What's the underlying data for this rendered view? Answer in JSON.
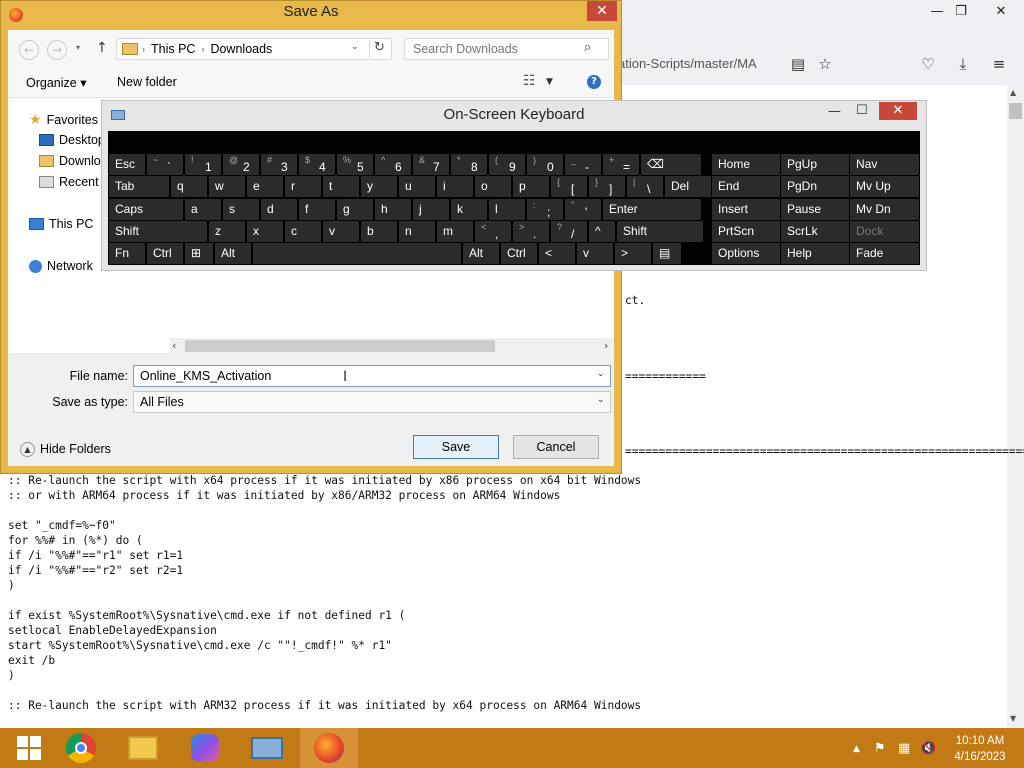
{
  "browser": {
    "url_fragment": "ation-Scripts/master/MA",
    "icons": [
      "reader-icon",
      "star-icon",
      "pocket-icon",
      "download-icon",
      "menu-icon"
    ],
    "partial_text_1": "ct.",
    "partial_text_2": "============",
    "partial_text_3": "==================================================================",
    "code_lines": [
      ":: Re-launch the script with x64 process if it was initiated by x86 process on x64 bit Windows",
      ":: or with ARM64 process if it was initiated by x86/ARM32 process on ARM64 Windows",
      "",
      "set \"_cmdf=%~f0\"",
      "for %%# in (%*) do (",
      "if /i \"%%#\"==\"r1\" set r1=1",
      "if /i \"%%#\"==\"r2\" set r2=1",
      ")",
      "",
      "if exist %SystemRoot%\\Sysnative\\cmd.exe if not defined r1 (",
      "setlocal EnableDelayedExpansion",
      "start %SystemRoot%\\Sysnative\\cmd.exe /c \"\"!_cmdf!\" %* r1\"",
      "exit /b",
      ")",
      "",
      ":: Re-launch the script with ARM32 process if it was initiated by x64 process on ARM64 Windows"
    ]
  },
  "dialog": {
    "title": "Save As",
    "breadcrumb": [
      "This PC",
      "Downloads"
    ],
    "search_placeholder": "Search Downloads",
    "organize_label": "Organize ▾",
    "new_folder_label": "New folder",
    "tree": {
      "favorites": "Favorites",
      "desktop": "Desktop",
      "downloads": "Downloads",
      "recent": "Recent places",
      "this_pc": "This PC",
      "network": "Network"
    },
    "file_name_label": "File name:",
    "file_name_value": "Online_KMS_Activation",
    "save_type_label": "Save as type:",
    "save_type_value": "All Files",
    "hide_folders": "Hide Folders",
    "save_button": "Save",
    "cancel_button": "Cancel"
  },
  "osk": {
    "title": "On-Screen Keyboard",
    "rows": [
      [
        {
          "m": "Esc"
        },
        {
          "s": "~",
          "m": "`"
        },
        {
          "s": "!",
          "m": "1"
        },
        {
          "s": "@",
          "m": "2"
        },
        {
          "s": "#",
          "m": "3"
        },
        {
          "s": "$",
          "m": "4"
        },
        {
          "s": "%",
          "m": "5"
        },
        {
          "s": "^",
          "m": "6"
        },
        {
          "s": "&",
          "m": "7"
        },
        {
          "s": "*",
          "m": "8"
        },
        {
          "s": "(",
          "m": "9"
        },
        {
          "s": ")",
          "m": "0"
        },
        {
          "s": "_",
          "m": "-"
        },
        {
          "s": "+",
          "m": "="
        },
        {
          "m": "⌫"
        }
      ],
      [
        {
          "m": "Tab"
        },
        {
          "m": "q"
        },
        {
          "m": "w"
        },
        {
          "m": "e"
        },
        {
          "m": "r"
        },
        {
          "m": "t"
        },
        {
          "m": "y"
        },
        {
          "m": "u"
        },
        {
          "m": "i"
        },
        {
          "m": "o"
        },
        {
          "m": "p"
        },
        {
          "s": "{",
          "m": "["
        },
        {
          "s": "}",
          "m": "]"
        },
        {
          "s": "|",
          "m": "\\"
        },
        {
          "m": "Del"
        }
      ],
      [
        {
          "m": "Caps"
        },
        {
          "m": "a"
        },
        {
          "m": "s"
        },
        {
          "m": "d"
        },
        {
          "m": "f"
        },
        {
          "m": "g"
        },
        {
          "m": "h"
        },
        {
          "m": "j"
        },
        {
          "m": "k"
        },
        {
          "m": "l"
        },
        {
          "s": ":",
          "m": ";"
        },
        {
          "s": "\"",
          "m": "'"
        },
        {
          "m": "Enter"
        }
      ],
      [
        {
          "m": "Shift"
        },
        {
          "m": "z"
        },
        {
          "m": "x"
        },
        {
          "m": "c"
        },
        {
          "m": "v"
        },
        {
          "m": "b"
        },
        {
          "m": "n"
        },
        {
          "m": "m"
        },
        {
          "s": "<",
          "m": ","
        },
        {
          "s": ">",
          "m": "."
        },
        {
          "s": "?",
          "m": "/"
        },
        {
          "m": "^"
        },
        {
          "m": "Shift"
        }
      ],
      [
        {
          "m": "Fn"
        },
        {
          "m": "Ctrl"
        },
        {
          "m": "⊞"
        },
        {
          "m": "Alt"
        },
        {
          "m": ""
        },
        {
          "m": "Alt"
        },
        {
          "m": "Ctrl"
        },
        {
          "m": "<"
        },
        {
          "m": "v"
        },
        {
          "m": ">"
        },
        {
          "m": "▤"
        }
      ]
    ],
    "nav_keys": [
      [
        "Home",
        "PgUp",
        "Nav"
      ],
      [
        "End",
        "PgDn",
        "Mv Up"
      ],
      [
        "Insert",
        "Pause",
        "Mv Dn"
      ],
      [
        "PrtScn",
        "ScrLk",
        "Dock"
      ],
      [
        "Options",
        "Help",
        "Fade"
      ]
    ]
  },
  "taskbar": {
    "apps": [
      "start-icon",
      "chrome-icon",
      "file-explorer-icon",
      "copilot-icon",
      "osk-icon",
      "firefox-icon"
    ],
    "time": "10:10 AM",
    "date": "4/16/2023"
  }
}
